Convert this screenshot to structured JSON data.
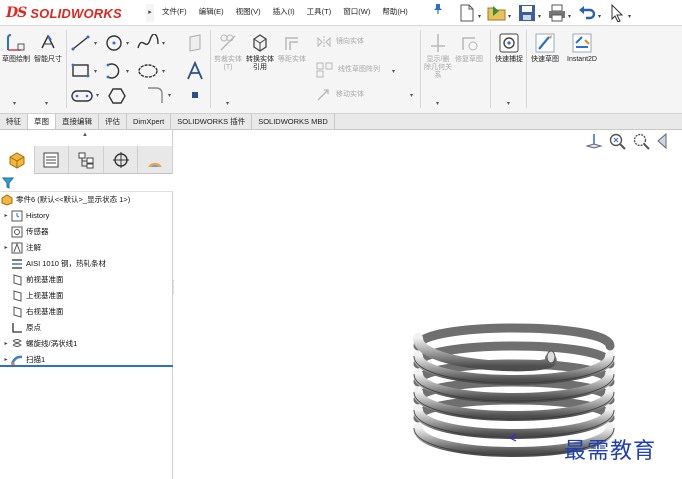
{
  "app": {
    "logo_ds": "DS",
    "logo_name": "SOLIDWORKS",
    "logo_arrow": "▸"
  },
  "menu": [
    "文件(F)",
    "编辑(E)",
    "视图(V)",
    "插入(I)",
    "工具(T)",
    "窗口(W)",
    "帮助(H)"
  ],
  "ribbon": {
    "sketch": "草图绘制",
    "smart_dim": "智能尺寸",
    "trim": "剪裁实体(T)",
    "convert": "转换实体引用",
    "offset": "等距实体",
    "mirror": "镜向实体",
    "linear_pattern": "线性草图阵列",
    "move": "移动实体",
    "display_relations": "显示/删除几何关系",
    "repair": "修复草图",
    "quick_snap": "快速捕捉",
    "rapid_sketch": "快速草图",
    "instant2d": "Instant2D"
  },
  "tabs": [
    "特征",
    "草图",
    "直接编辑",
    "评估",
    "DimXpert",
    "SOLIDWORKS 插件",
    "SOLIDWORKS MBD"
  ],
  "active_tab": "草图",
  "tree": {
    "root": "零件6 (默认<<默认>_显示状态 1>)",
    "items": [
      {
        "label": "History",
        "icon": "history-icon",
        "expandable": true
      },
      {
        "label": "传感器",
        "icon": "sensor-icon",
        "expandable": false
      },
      {
        "label": "注解",
        "icon": "annotation-icon",
        "expandable": true
      },
      {
        "label": "AISI 1010 钢，热轧条材",
        "icon": "material-icon",
        "expandable": false
      },
      {
        "label": "前视基准面",
        "icon": "plane-icon",
        "expandable": false
      },
      {
        "label": "上视基准面",
        "icon": "plane-icon",
        "expandable": false
      },
      {
        "label": "右视基准面",
        "icon": "plane-icon",
        "expandable": false
      },
      {
        "label": "原点",
        "icon": "origin-icon",
        "expandable": false
      },
      {
        "label": "螺旋线/涡状线1",
        "icon": "helix-icon",
        "expandable": true
      },
      {
        "label": "扫描1",
        "icon": "sweep-icon",
        "expandable": true
      }
    ]
  },
  "watermark": "最需教育",
  "colors": {
    "accent": "#2b6fd1",
    "brand_red": "#e2261f",
    "watermark": "#1f3fb4",
    "disabled": "#a8a8a8"
  }
}
